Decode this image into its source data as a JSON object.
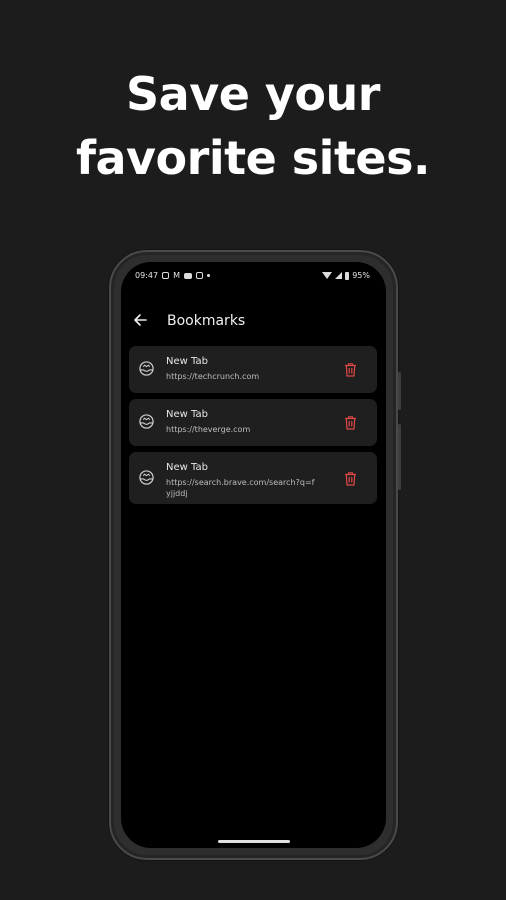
{
  "headline": {
    "line1": "Save your",
    "line2": "favorite sites."
  },
  "statusbar": {
    "time": "09:47",
    "left_text": "M",
    "battery": "95%"
  },
  "appbar": {
    "title": "Bookmarks"
  },
  "bookmarks": [
    {
      "title": "New Tab",
      "url": "https://techcrunch.com"
    },
    {
      "title": "New Tab",
      "url": "https://theverge.com"
    },
    {
      "title": "New Tab",
      "url": "https://search.brave.com/search?q=fyjjddj"
    }
  ],
  "colors": {
    "background": "#1c1c1c",
    "card": "#1f1f1f",
    "trash": "#e04848",
    "screen": "#000000"
  },
  "icons": {
    "back": "arrow-left-icon",
    "bookmark": "globe-icon",
    "delete": "trash-icon"
  }
}
